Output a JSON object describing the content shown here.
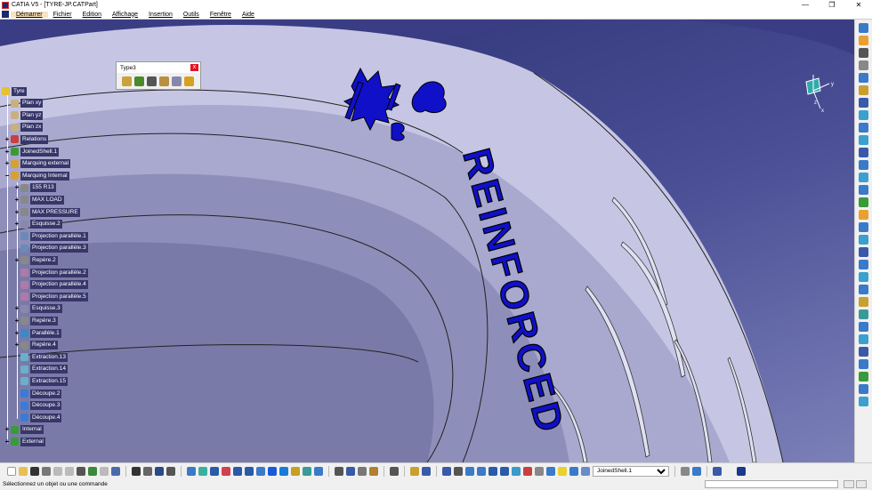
{
  "window": {
    "title": "CATIA V5 - [TYRE-JP.CATPart]",
    "controls": [
      "—",
      "❐",
      "✕"
    ]
  },
  "menu": [
    "Démarrer",
    "Fichier",
    "Edition",
    "Affichage",
    "Insertion",
    "Outils",
    "Fenêtre",
    "Aide"
  ],
  "tree": [
    {
      "label": "Tyre",
      "level": 0,
      "expand": ""
    },
    {
      "label": "Plan xy",
      "level": 1,
      "expand": ""
    },
    {
      "label": "Plan yz",
      "level": 1,
      "expand": ""
    },
    {
      "label": "Plan zx",
      "level": 1,
      "expand": ""
    },
    {
      "label": "Relations",
      "level": 1,
      "expand": "+"
    },
    {
      "label": "JoinedShell.1",
      "level": 1,
      "expand": "+"
    },
    {
      "label": "Marquing external",
      "level": 1,
      "expand": "+"
    },
    {
      "label": "Marquing Internal",
      "level": 1,
      "expand": "−"
    },
    {
      "label": "155 R13",
      "level": 2,
      "expand": "+"
    },
    {
      "label": "MAX  LOAD",
      "level": 2,
      "expand": "+"
    },
    {
      "label": "MAX  PRESSURE",
      "level": 2,
      "expand": "+"
    },
    {
      "label": "Esquisse.2",
      "level": 2,
      "expand": "+"
    },
    {
      "label": "Projection parallèle.1",
      "level": 2,
      "expand": ""
    },
    {
      "label": "Projection parallèle.3",
      "level": 2,
      "expand": ""
    },
    {
      "label": "Repère.2",
      "level": 2,
      "expand": "+"
    },
    {
      "label": "Projection parallèle.2",
      "level": 2,
      "expand": ""
    },
    {
      "label": "Projection parallèle.4",
      "level": 2,
      "expand": ""
    },
    {
      "label": "Projection parallèle.5",
      "level": 2,
      "expand": ""
    },
    {
      "label": "Esquisse.3",
      "level": 2,
      "expand": "+"
    },
    {
      "label": "Repère.3",
      "level": 2,
      "expand": "+"
    },
    {
      "label": "Parallèle.1",
      "level": 2,
      "expand": "+"
    },
    {
      "label": "Repère.4",
      "level": 2,
      "expand": "+"
    },
    {
      "label": "Extraction.13",
      "level": 2,
      "expand": ""
    },
    {
      "label": "Extraction.14",
      "level": 2,
      "expand": ""
    },
    {
      "label": "Extraction.15",
      "level": 2,
      "expand": ""
    },
    {
      "label": "Découpe.2",
      "level": 2,
      "expand": ""
    },
    {
      "label": "Découpe.3",
      "level": 2,
      "expand": ""
    },
    {
      "label": "Découpe.4",
      "level": 2,
      "expand": ""
    },
    {
      "label": "Internal",
      "level": 1,
      "expand": "+"
    },
    {
      "label": "External",
      "level": 1,
      "expand": "+"
    }
  ],
  "type3_toolbar": {
    "title": "Type3",
    "close": "x"
  },
  "model_text": "REINFORCED",
  "compass": {
    "x": "x",
    "y": "y",
    "z": "z"
  },
  "bottom_toolbar": {
    "current_body": "JoinedShell.1"
  },
  "status": {
    "message": "Sélectionnez un objet ou une commande",
    "command_input": ""
  },
  "colors": {
    "tree_label_bg": "#36366a",
    "marking_blue": "#1010c8",
    "tyre": "#c8c8e6"
  }
}
